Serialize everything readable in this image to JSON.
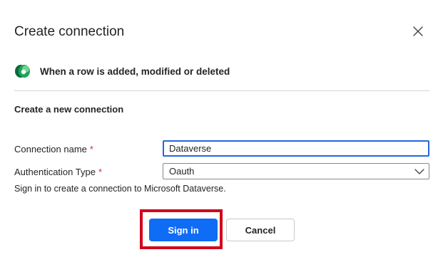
{
  "dialog": {
    "title": "Create connection",
    "close_icon": "close-icon"
  },
  "trigger": {
    "icon": "dataverse-icon",
    "label": "When a row is added, modified or deleted",
    "icon_color": "#1a9e5a"
  },
  "form": {
    "section_heading": "Create a new connection",
    "connection_name": {
      "label": "Connection name",
      "required_marker": "*",
      "value": "Dataverse"
    },
    "authentication_type": {
      "label": "Authentication Type",
      "required_marker": "*",
      "selected": "Oauth",
      "chevron_icon": "chevron-down-icon"
    },
    "helper_text": "Sign in to create a connection to Microsoft Dataverse."
  },
  "actions": {
    "sign_in_label": "Sign in",
    "cancel_label": "Cancel",
    "primary_color": "#0f6cf5",
    "highlight_color": "#d0021b"
  }
}
